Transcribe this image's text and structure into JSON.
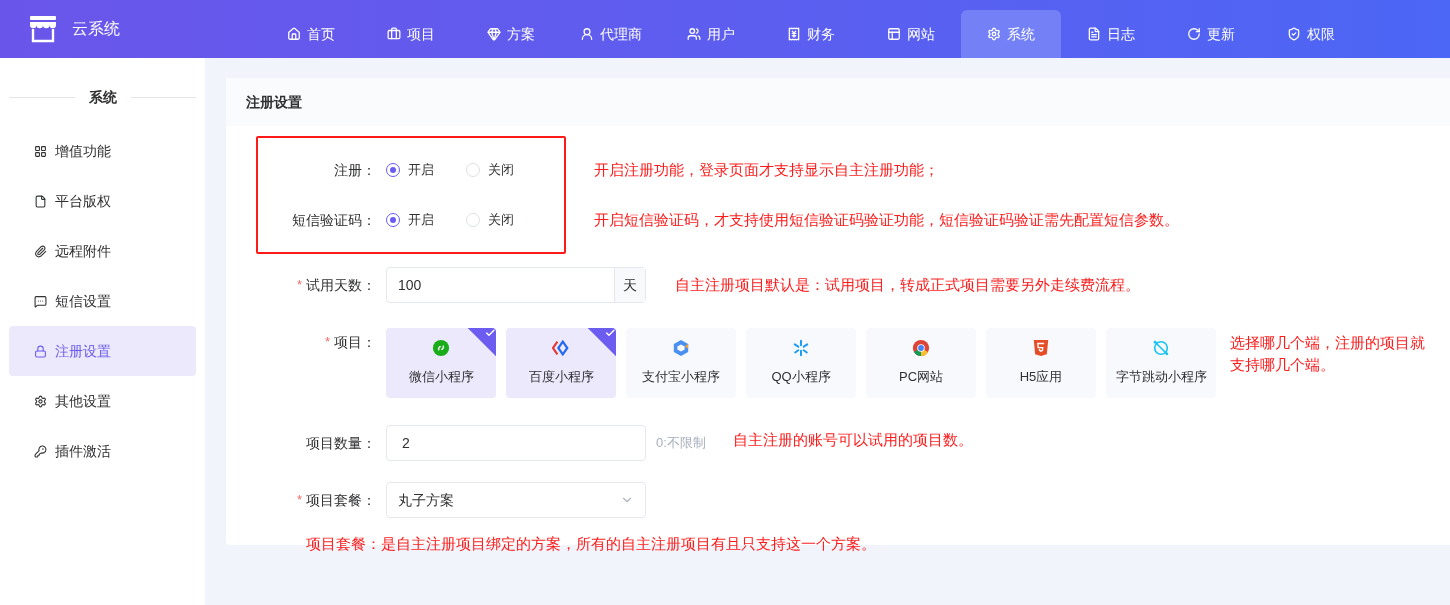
{
  "app": {
    "name": "云系统"
  },
  "nav": [
    {
      "label": "首页",
      "selected": false
    },
    {
      "label": "项目",
      "selected": false
    },
    {
      "label": "方案",
      "selected": false
    },
    {
      "label": "代理商",
      "selected": false
    },
    {
      "label": "用户",
      "selected": false
    },
    {
      "label": "财务",
      "selected": false
    },
    {
      "label": "网站",
      "selected": false
    },
    {
      "label": "系统",
      "selected": true
    },
    {
      "label": "日志",
      "selected": false
    },
    {
      "label": "更新",
      "selected": false
    },
    {
      "label": "权限",
      "selected": false
    }
  ],
  "sidebar": {
    "title": "系统",
    "items": [
      {
        "label": "增值功能",
        "selected": false
      },
      {
        "label": "平台版权",
        "selected": false
      },
      {
        "label": "远程附件",
        "selected": false
      },
      {
        "label": "短信设置",
        "selected": false
      },
      {
        "label": "注册设置",
        "selected": true
      },
      {
        "label": "其他设置",
        "selected": false
      },
      {
        "label": "插件激活",
        "selected": false
      }
    ]
  },
  "card": {
    "title": "注册设置"
  },
  "form": {
    "toggles": [
      {
        "label": "注册：",
        "options": [
          {
            "label": "开启",
            "selected": true
          },
          {
            "label": "关闭",
            "selected": false
          }
        ],
        "note": "开启注册功能，登录页面才支持显示自主注册功能；"
      },
      {
        "label": "短信验证码：",
        "options": [
          {
            "label": "开启",
            "selected": true
          },
          {
            "label": "关闭",
            "selected": false
          }
        ],
        "note": "开启短信验证码，才支持使用短信验证码验证功能，短信验证码验证需先配置短信参数。"
      }
    ],
    "trial_days": {
      "mark": "*",
      "label": "试用天数：",
      "value": "100",
      "suffix": "天",
      "note": "自主注册项目默认是：试用项目，转成正式项目需要另外走续费流程。"
    },
    "platforms": {
      "mark": "*",
      "label": "项目：",
      "note": "选择哪几个端，注册的项目就支持哪几个端。",
      "items": [
        {
          "label": "微信小程序",
          "checked": true
        },
        {
          "label": "百度小程序",
          "checked": true
        },
        {
          "label": "支付宝小程序",
          "checked": false
        },
        {
          "label": "QQ小程序",
          "checked": false
        },
        {
          "label": "PC网站",
          "checked": false
        },
        {
          "label": "H5应用",
          "checked": false
        },
        {
          "label": "字节跳动小程序",
          "checked": false
        }
      ]
    },
    "project_count": {
      "label": "项目数量：",
      "value": "2",
      "hint": "0:不限制",
      "note": "自主注册的账号可以试用的项目数。"
    },
    "plan": {
      "mark": "*",
      "label": "项目套餐：",
      "value": "丸子方案",
      "note": "项目套餐：是自主注册项目绑定的方案，所有的自主注册项目有且只支持这一个方案。"
    }
  }
}
